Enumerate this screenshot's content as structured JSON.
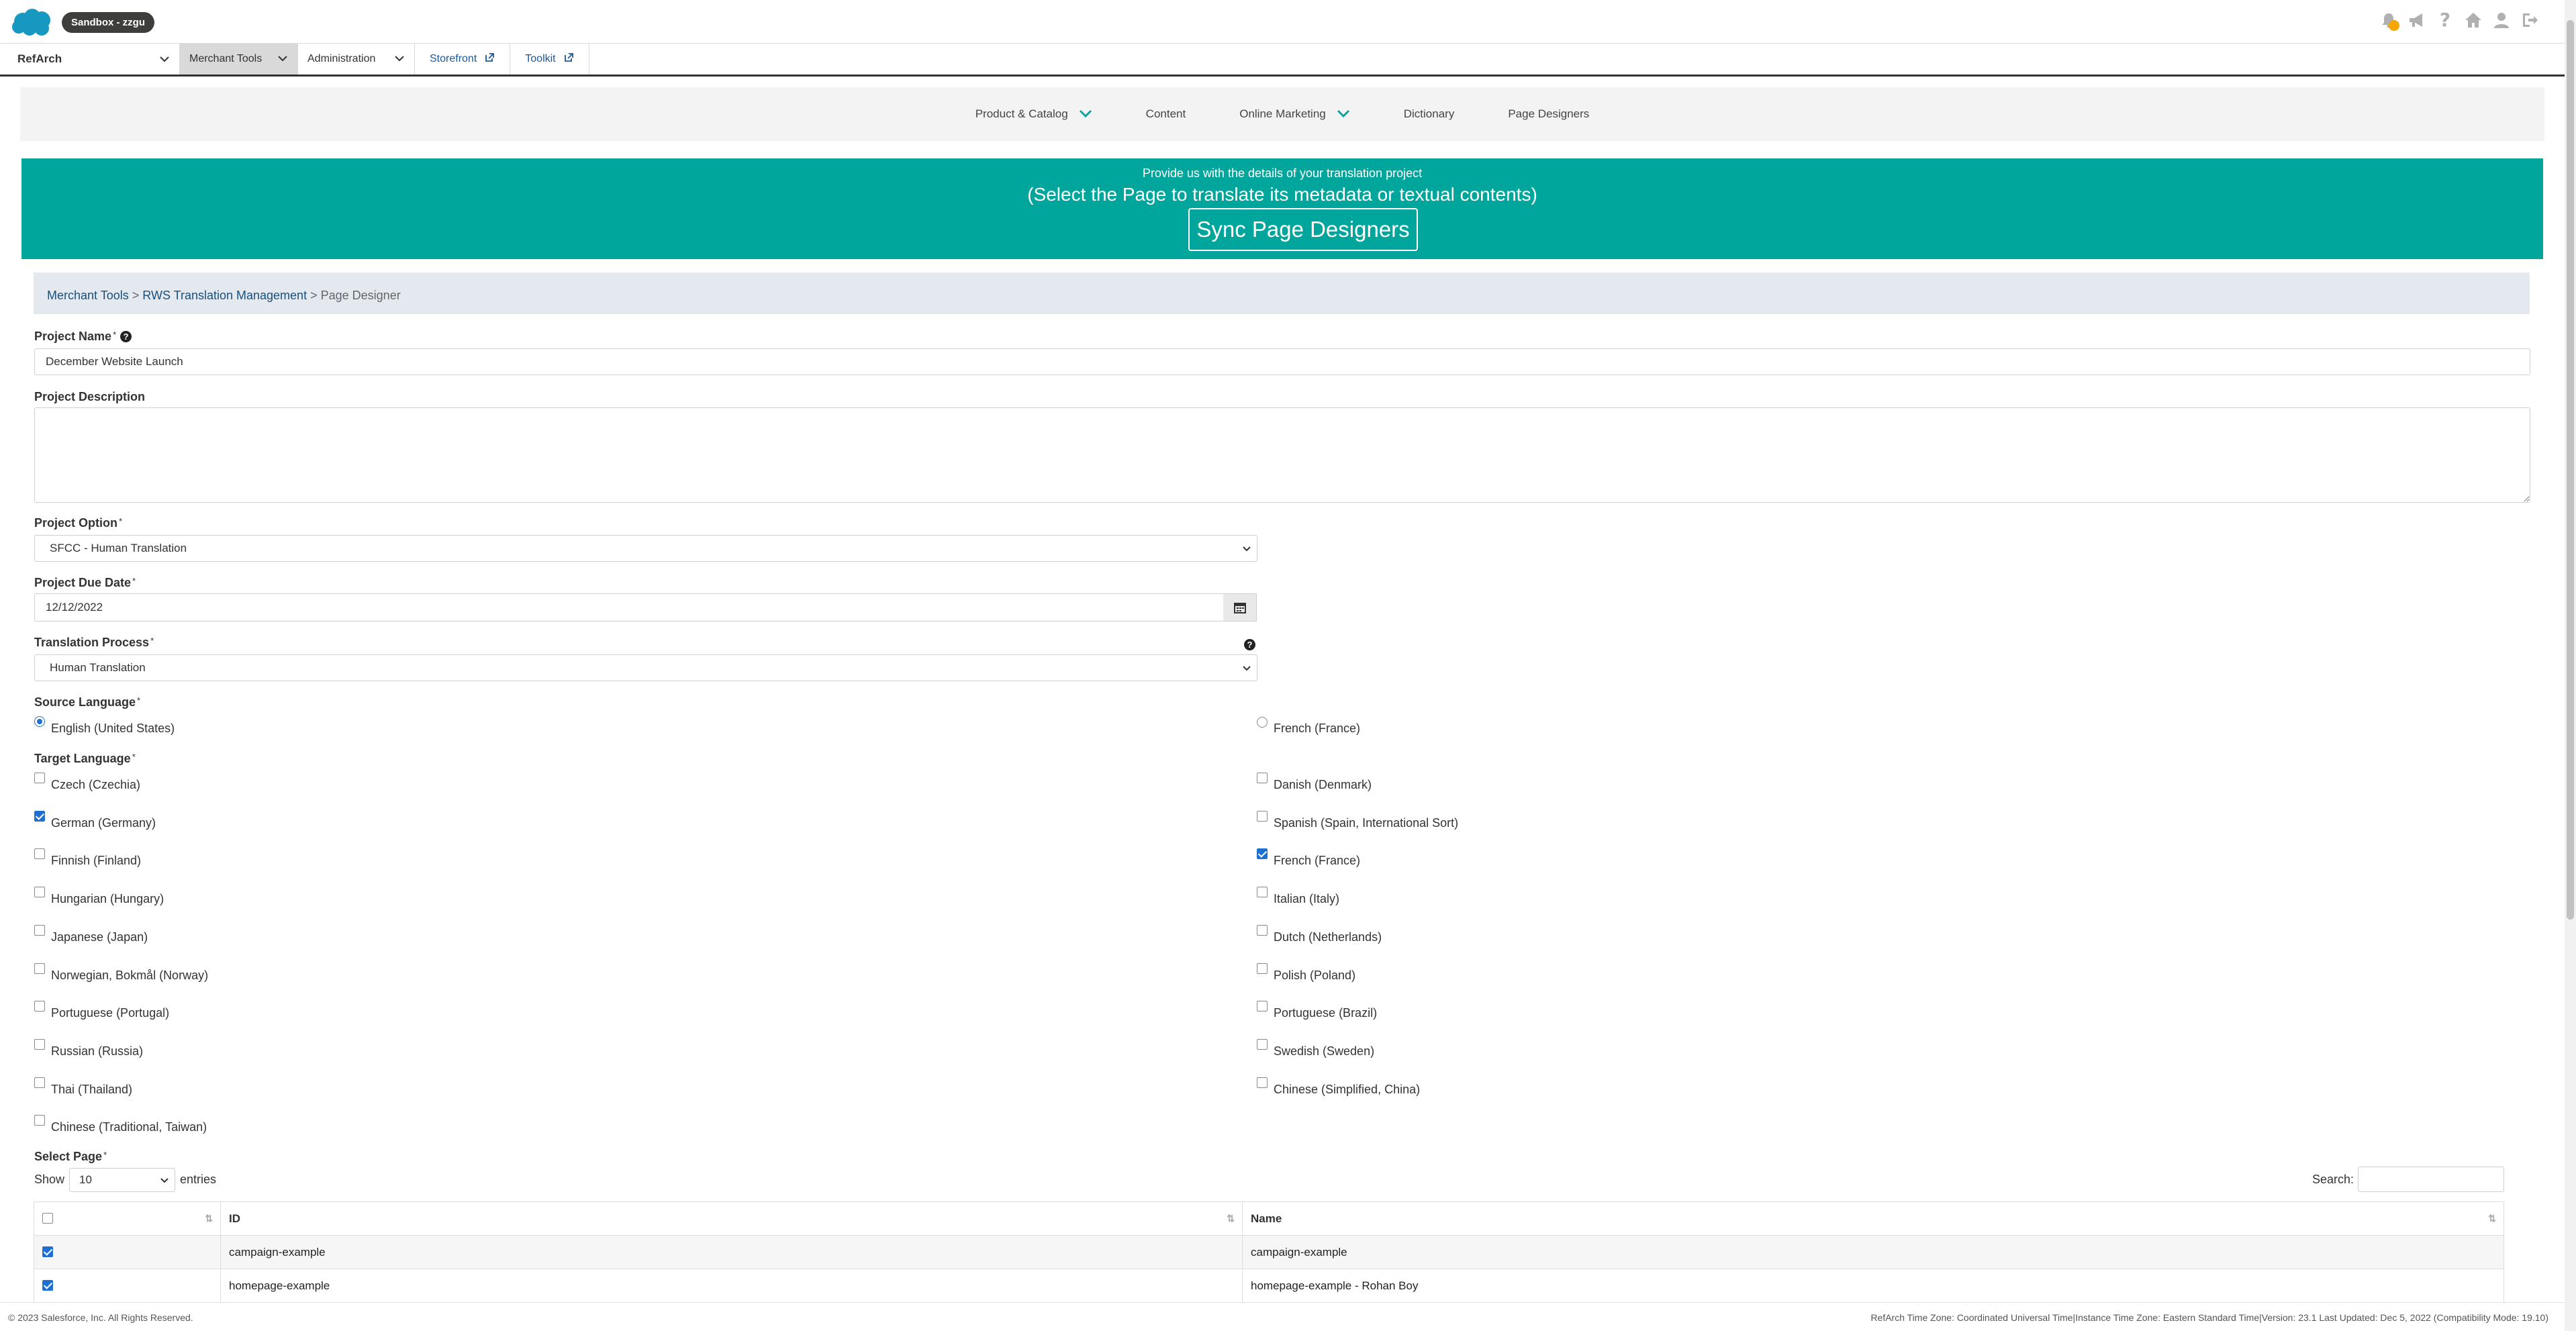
{
  "header": {
    "badge": "Sandbox - zzgu",
    "icons": [
      "notifications-icon",
      "megaphone-icon",
      "help-icon",
      "home-icon",
      "user-icon",
      "logout-icon"
    ],
    "notification_color": "#f7a600"
  },
  "menubar": {
    "site": "RefArch",
    "merchant_tools": "Merchant Tools",
    "administration": "Administration",
    "storefront": "Storefront",
    "toolkit": "Toolkit"
  },
  "modnav": {
    "items": [
      "Product & Catalog",
      "Content",
      "Online Marketing",
      "Dictionary",
      "Page Designers"
    ]
  },
  "banner": {
    "line1": "Provide us with the details of your translation project",
    "line2": "(Select the Page to translate its metadata or textual contents)",
    "sync_button": "Sync Page Designers",
    "color": "#00a69c"
  },
  "breadcrumb": {
    "item1": "Merchant Tools",
    "sep": ">",
    "item2": "RWS Translation Management",
    "current": "Page Designer"
  },
  "form": {
    "project_name_label": "Project Name",
    "project_name_value": "December Website Launch",
    "project_description_label": "Project Description",
    "project_description_value": "",
    "project_option_label": "Project Option",
    "project_option_value": "SFCC - Human Translation",
    "due_date_label": "Project Due Date",
    "due_date_value": "12/12/2022",
    "translation_process_label": "Translation Process",
    "translation_process_value": "Human Translation",
    "required_mark": "*"
  },
  "source_language": {
    "label": "Source Language",
    "options": [
      {
        "label": "English (United States)",
        "selected": true
      },
      {
        "label": "French (France)",
        "selected": false
      }
    ]
  },
  "target_language": {
    "label": "Target Language",
    "options": [
      {
        "label": "Czech (Czechia)",
        "checked": false
      },
      {
        "label": "Danish (Denmark)",
        "checked": false
      },
      {
        "label": "German (Germany)",
        "checked": true
      },
      {
        "label": "Spanish (Spain, International Sort)",
        "checked": false
      },
      {
        "label": "Finnish (Finland)",
        "checked": false
      },
      {
        "label": "French (France)",
        "checked": true
      },
      {
        "label": "Hungarian (Hungary)",
        "checked": false
      },
      {
        "label": "Italian (Italy)",
        "checked": false
      },
      {
        "label": "Japanese (Japan)",
        "checked": false
      },
      {
        "label": "Dutch (Netherlands)",
        "checked": false
      },
      {
        "label": "Norwegian, Bokmål (Norway)",
        "checked": false
      },
      {
        "label": "Polish (Poland)",
        "checked": false
      },
      {
        "label": "Portuguese (Portugal)",
        "checked": false
      },
      {
        "label": "Portuguese (Brazil)",
        "checked": false
      },
      {
        "label": "Russian (Russia)",
        "checked": false
      },
      {
        "label": "Swedish (Sweden)",
        "checked": false
      },
      {
        "label": "Thai (Thailand)",
        "checked": false
      },
      {
        "label": "Chinese (Simplified, China)",
        "checked": false
      },
      {
        "label": "Chinese (Traditional, Taiwan)",
        "checked": false
      }
    ]
  },
  "select_page": {
    "label": "Select Page",
    "show_label": "Show",
    "entries_value": "10",
    "entries_label": "entries",
    "search_label": "Search:",
    "search_value": "",
    "columns": [
      "ID",
      "Name"
    ],
    "rows": [
      {
        "checked": true,
        "id": "campaign-example",
        "name": "campaign-example"
      },
      {
        "checked": true,
        "id": "homepage-example",
        "name": "homepage-example - Rohan Boy"
      }
    ]
  },
  "footer": {
    "left": "© 2023 Salesforce, Inc. All Rights Reserved.",
    "right": "RefArch Time Zone: Coordinated Universal Time|Instance Time Zone: Eastern Standard Time|Version: 23.1 Last Updated: Dec 5, 2022 (Compatibility Mode: 19.10)"
  }
}
